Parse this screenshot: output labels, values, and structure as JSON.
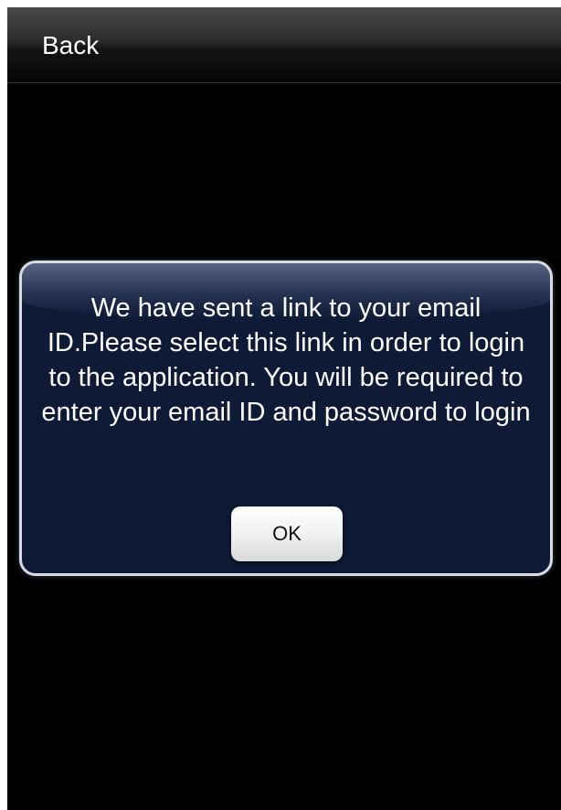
{
  "nav": {
    "back_label": "Back"
  },
  "alert": {
    "message": "We have sent a link to your email ID.Please select this link in order to login to the application. You will be required to enter your email ID and password to login",
    "ok_label": "OK"
  },
  "colors": {
    "background": "#000000",
    "alert_fill": "#0f1a36",
    "alert_border": "#d8dbe2",
    "text": "#ffffff"
  }
}
